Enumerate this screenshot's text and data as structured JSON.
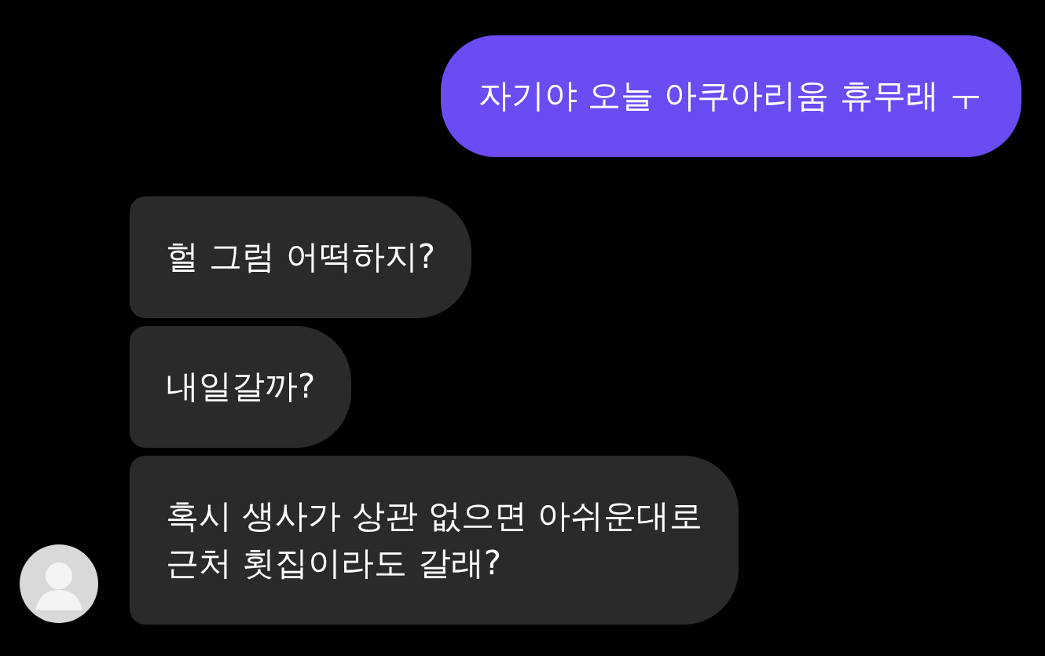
{
  "messages": [
    {
      "kind": "sent",
      "text": "자기야 오늘 아쿠아리움 휴무래 ㅜ"
    },
    {
      "kind": "received",
      "text": "헐 그럼 어떡하지?"
    },
    {
      "kind": "received",
      "text": "내일갈까?"
    },
    {
      "kind": "received",
      "text": "혹시 생사가 상관 없으면 아쉬운대로\n근처 횟집이라도 갈래?"
    }
  ]
}
